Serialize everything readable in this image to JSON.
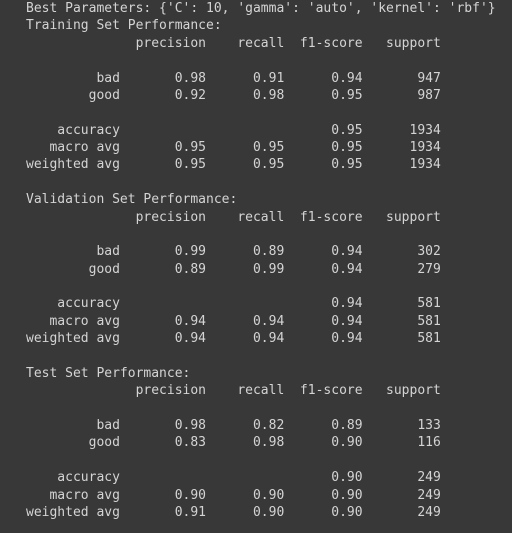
{
  "output": {
    "lines": [
      "Best Parameters: {'C': 10, 'gamma': 'auto', 'kernel': 'rbf'}",
      "Training Set Performance:",
      "              precision    recall  f1-score   support",
      "",
      "         bad       0.98      0.91      0.94       947",
      "        good       0.92      0.98      0.95       987",
      "",
      "    accuracy                           0.95      1934",
      "   macro avg       0.95      0.95      0.95      1934",
      "weighted avg       0.95      0.95      0.95      1934",
      "",
      "Validation Set Performance:",
      "              precision    recall  f1-score   support",
      "",
      "         bad       0.99      0.89      0.94       302",
      "        good       0.89      0.99      0.94       279",
      "",
      "    accuracy                           0.94       581",
      "   macro avg       0.94      0.94      0.94       581",
      "weighted avg       0.94      0.94      0.94       581",
      "",
      "Test Set Performance:",
      "              precision    recall  f1-score   support",
      "",
      "         bad       0.98      0.82      0.89       133",
      "        good       0.83      0.98      0.90       116",
      "",
      "    accuracy                           0.90       249",
      "   macro avg       0.90      0.90      0.90       249",
      "weighted avg       0.91      0.90      0.90       249"
    ]
  }
}
